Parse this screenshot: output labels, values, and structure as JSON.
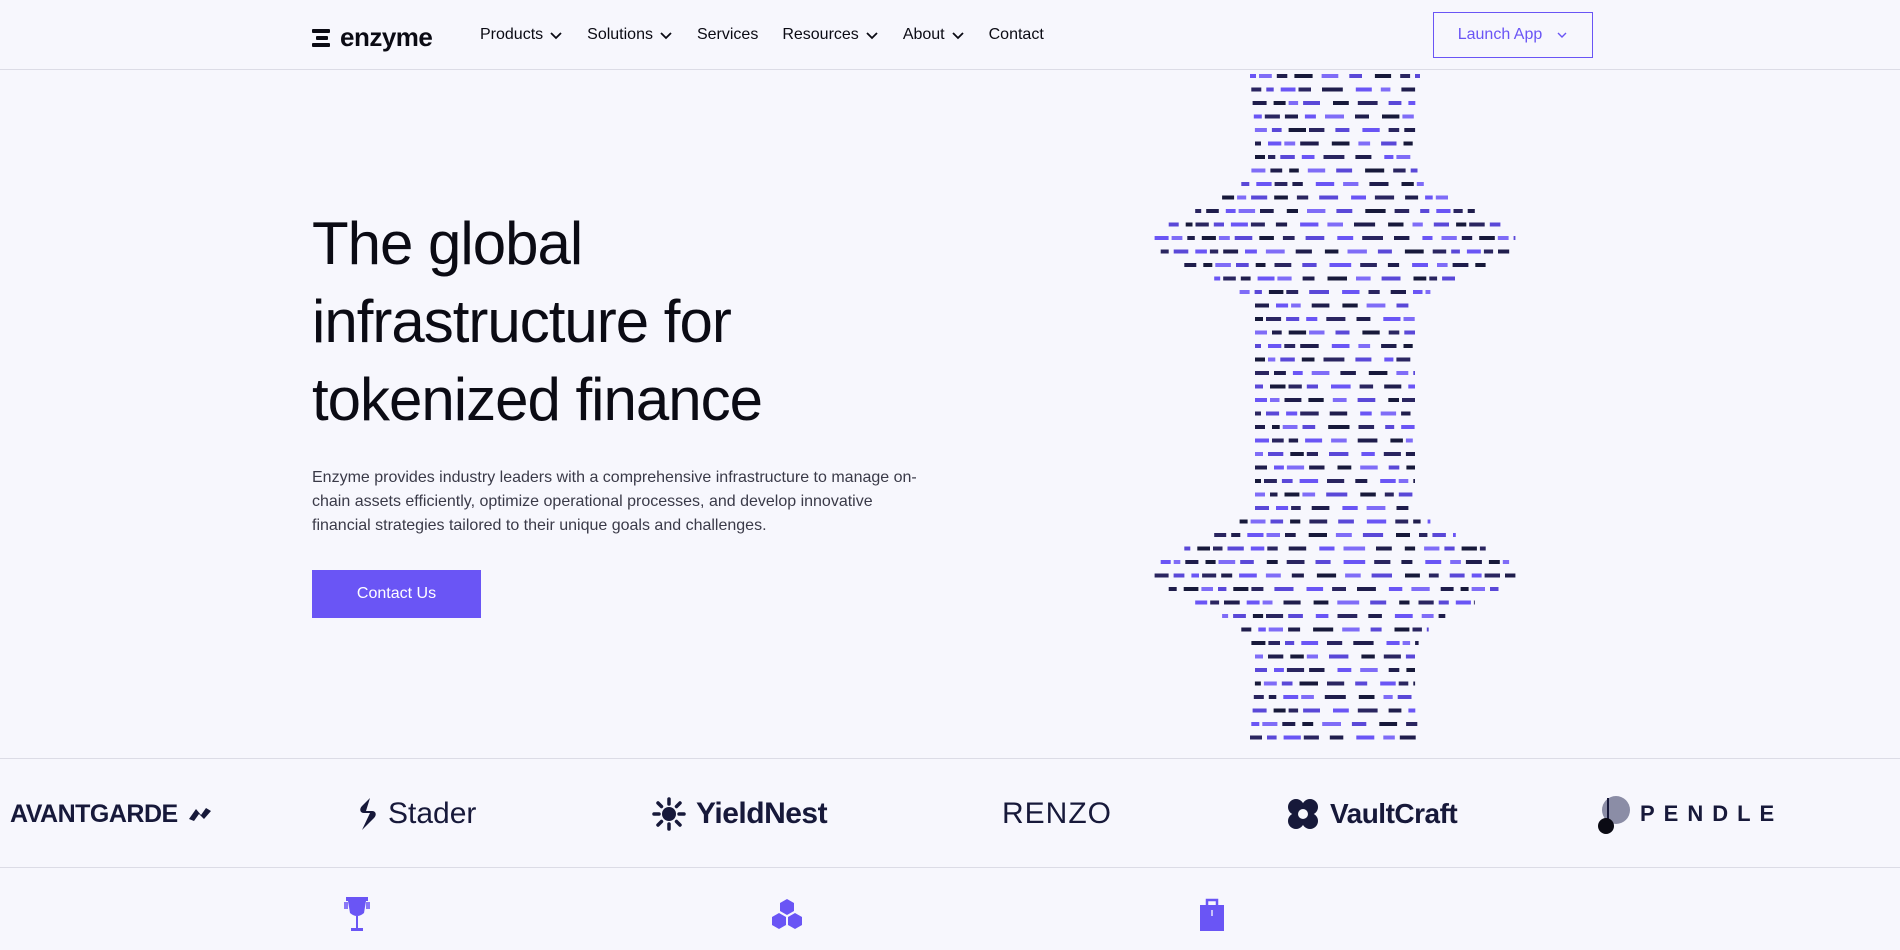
{
  "brand": {
    "name": "enzyme"
  },
  "nav": {
    "items": [
      {
        "label": "Products",
        "dropdown": true
      },
      {
        "label": "Solutions",
        "dropdown": true
      },
      {
        "label": "Services",
        "dropdown": false
      },
      {
        "label": "Resources",
        "dropdown": true
      },
      {
        "label": "About",
        "dropdown": true
      },
      {
        "label": "Contact",
        "dropdown": false
      }
    ],
    "launch_label": "Launch App"
  },
  "hero": {
    "title": "The global infrastructure for tokenized finance",
    "description": "Enzyme provides industry leaders with a comprehensive infrastructure to manage on-chain assets efficiently, optimize operational processes, and develop innovative financial strategies tailored to their unique goals and challenges.",
    "cta_label": "Contact Us"
  },
  "partners": [
    "AVANTGARDE",
    "Stader",
    "YieldNest",
    "RENZO",
    "VaultCraft",
    "PENDLE"
  ],
  "features": {
    "icons": [
      "trophy-icon",
      "hexagons-icon",
      "bag-icon"
    ]
  },
  "colors": {
    "accent": "#6a55f5",
    "dark": "#17193a",
    "background": "#f7f7fd"
  }
}
